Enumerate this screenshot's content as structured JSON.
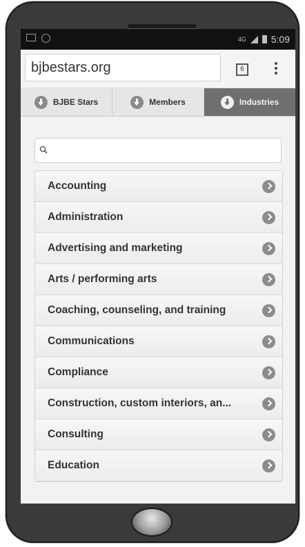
{
  "status_bar": {
    "network": "4G",
    "time": "5:09"
  },
  "browser": {
    "url": "bjbestars.org",
    "tab_count": "6"
  },
  "tabs": [
    {
      "label": "BJBE Stars",
      "active": false
    },
    {
      "label": "Members",
      "active": false
    },
    {
      "label": "Industries",
      "active": true
    }
  ],
  "search": {
    "placeholder": ""
  },
  "industries": [
    "Accounting",
    "Administration",
    "Advertising and marketing",
    "Arts / performing arts",
    "Coaching, counseling, and training",
    "Communications",
    "Compliance",
    "Construction, custom interiors, an...",
    "Consulting",
    "Education"
  ],
  "icons": {
    "tab_icon": "download-circle-icon",
    "row_icon": "chevron-right-circle-icon",
    "search_icon": "search-icon"
  }
}
